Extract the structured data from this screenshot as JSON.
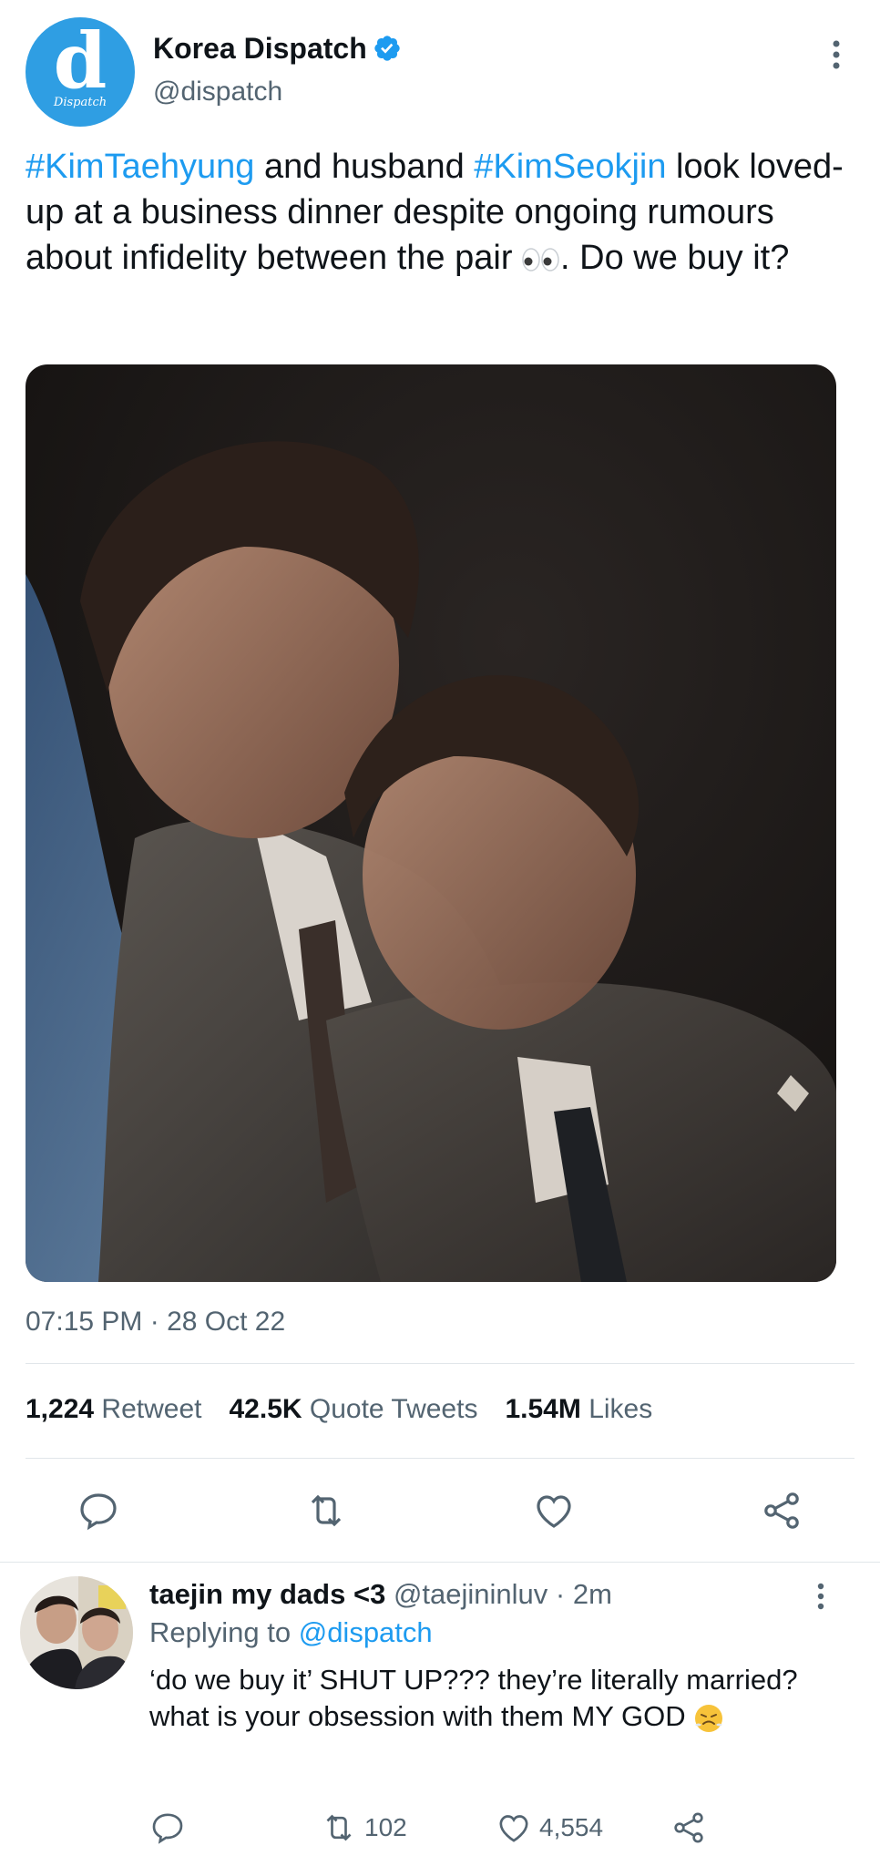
{
  "tweet": {
    "author_name": "Korea Dispatch",
    "author_handle": "@dispatch",
    "avatar_letter": "d",
    "avatar_sub": "Dispatch",
    "text_parts": {
      "tag1": "#KimTaehyung",
      "mid1": " and husband ",
      "tag2": "#KimSeokjin",
      "mid2": " look loved-up at a business dinner despite ongoing rumours about infidelity between the pair ",
      "end": ". Do we buy it?"
    },
    "timestamp": "07:15 PM · 28 Oct 22",
    "stats": {
      "retweets_count": "1,224",
      "retweets_label": "Retweet",
      "quotes_count": "42.5K",
      "quotes_label": "Quote Tweets",
      "likes_count": "1.54M",
      "likes_label": "Likes"
    }
  },
  "reply": {
    "name": "taejin my dads <3",
    "handle": "@taejininluv",
    "time": "· 2m",
    "replying_label": "Replying to",
    "replying_handle": "@dispatch",
    "text": "‘do we buy it’ SHUT UP??? they’re literally married? what is your obsession with them MY GOD",
    "retweets": "102",
    "likes": "4,554"
  },
  "colors": {
    "accent": "#1d9bf0",
    "secondary_text": "#536471",
    "avatar_bg": "#2f9ee3"
  },
  "icons": [
    "verified-badge-icon",
    "more-icon",
    "eyes-emoji-icon",
    "reply-icon",
    "retweet-icon",
    "like-icon",
    "share-icon",
    "steam-face-emoji-icon"
  ]
}
